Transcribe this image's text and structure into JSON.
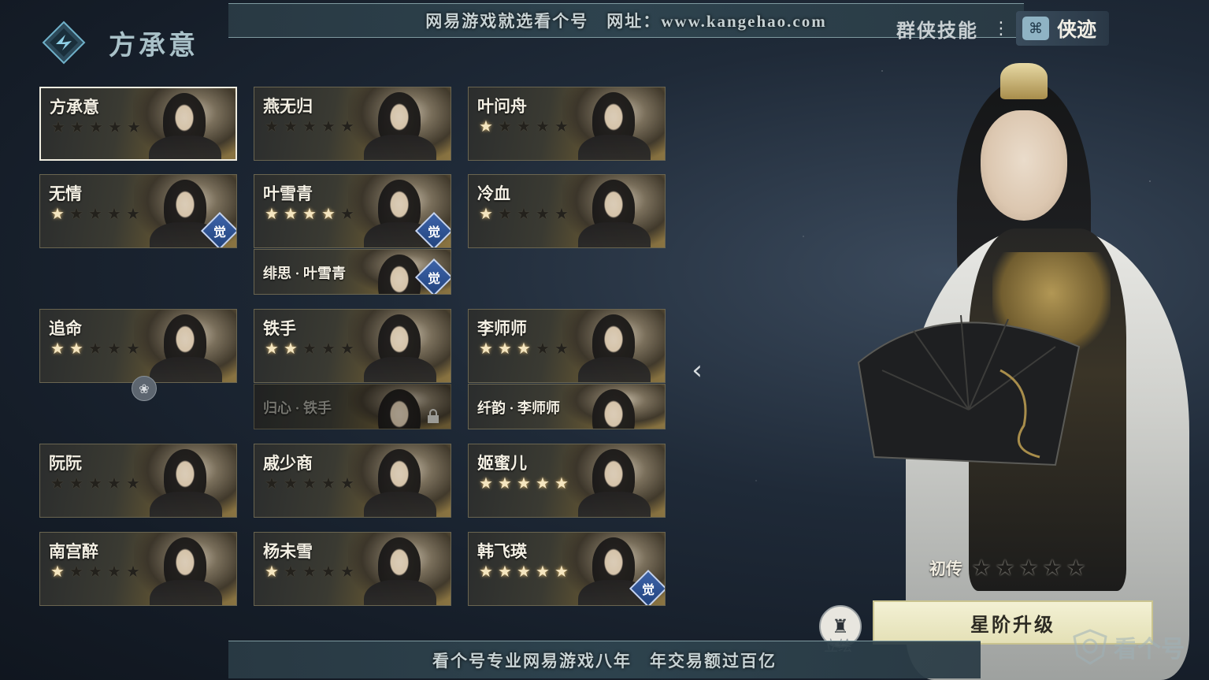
{
  "header": {
    "title": "方承意",
    "skills_label": "群侠技能",
    "more_icon": "vertical-dots",
    "traces_label": "侠迹"
  },
  "banners": {
    "top": "网易游戏就选看个号　网址：www.kangehao.com",
    "bottom": "看个号专业网易游戏八年　年交易额过百亿"
  },
  "roster": [
    {
      "name": "方承意",
      "stars": 0,
      "selected": true,
      "awakened": false
    },
    {
      "name": "燕无归",
      "stars": 0,
      "awakened": false
    },
    {
      "name": "叶问舟",
      "stars": 1,
      "awakened": false
    },
    {
      "name": "无情",
      "stars": 1,
      "awakened": true
    },
    {
      "name": "叶雪青",
      "stars": 4,
      "awakened": true
    },
    {
      "name": "冷血",
      "stars": 1,
      "awakened": false
    },
    {
      "name": "绯思 · 叶雪青",
      "variant": true,
      "awakened": true
    },
    {
      "name": "追命",
      "stars": 2,
      "awakened": false
    },
    {
      "name": "铁手",
      "stars": 2,
      "awakened": false
    },
    {
      "name": "李师师",
      "stars": 3,
      "awakened": false
    },
    {
      "name": "归心 · 铁手",
      "variant": true,
      "locked": true
    },
    {
      "name": "纤韵 · 李师师",
      "variant": true
    },
    {
      "name": "阮阮",
      "stars": 0,
      "awakened": false
    },
    {
      "name": "戚少商",
      "stars": 0,
      "awakened": false
    },
    {
      "name": "姬蜜儿",
      "stars": 5,
      "awakened": false
    },
    {
      "name": "南宫醉",
      "stars": 1,
      "awakened": false
    },
    {
      "name": "杨未雪",
      "stars": 1,
      "awakened": false
    },
    {
      "name": "韩飞瑛",
      "stars": 5,
      "awakened": true
    }
  ],
  "badges": {
    "awakened": "觉"
  },
  "detail": {
    "rank_label": "初传",
    "rank_stars": 5,
    "upgrade_label": "星阶升级",
    "portrait_label": "立绘"
  },
  "watermark": "看个号",
  "colors": {
    "accent_gold": "#8a7442",
    "awaken_blue": "#3d63a8",
    "button_cream": "#f3f1d4"
  }
}
